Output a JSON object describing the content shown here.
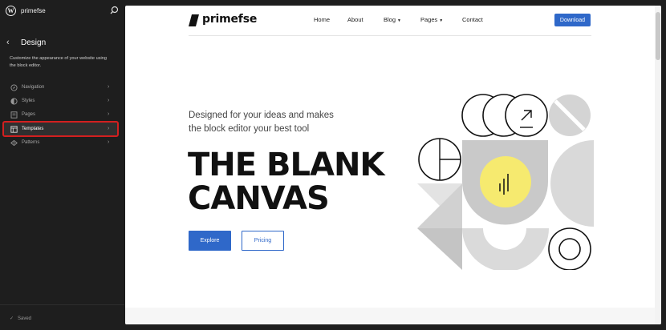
{
  "sidebar": {
    "site_name": "primefse",
    "panel_title": "Design",
    "panel_description": "Customize the appearance of your website using the block editor.",
    "items": [
      {
        "label": "Navigation",
        "icon": "navigation-icon"
      },
      {
        "label": "Styles",
        "icon": "styles-icon"
      },
      {
        "label": "Pages",
        "icon": "pages-icon"
      },
      {
        "label": "Templates",
        "icon": "templates-icon",
        "active": true
      },
      {
        "label": "Patterns",
        "icon": "patterns-icon"
      }
    ],
    "status": "Saved"
  },
  "site": {
    "brand": "primefse",
    "menu": [
      {
        "label": "Home"
      },
      {
        "label": "About"
      },
      {
        "label": "Blog",
        "has_submenu": true
      },
      {
        "label": "Pages",
        "has_submenu": true
      },
      {
        "label": "Contact"
      }
    ],
    "cta_label": "Download",
    "hero": {
      "subtitle_line1": "Designed for your ideas and makes",
      "subtitle_line2": "the block editor your best tool",
      "title_line1": "THE BLANK",
      "title_line2": "CANVAS",
      "primary_button": "Explore",
      "secondary_button": "Pricing"
    }
  },
  "colors": {
    "accent": "#2f68c9",
    "highlight_outline": "#d21f1f",
    "art_yellow": "#f6ea6f",
    "art_gray": "#c9c9c9"
  }
}
